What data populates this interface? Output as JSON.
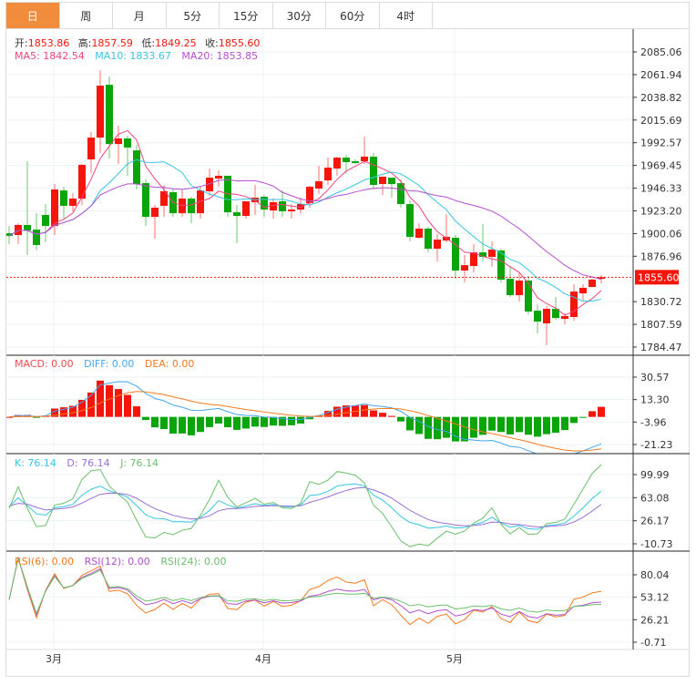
{
  "tabs": [
    {
      "label": "日",
      "active": true
    },
    {
      "label": "周"
    },
    {
      "label": "月"
    },
    {
      "label": "5分"
    },
    {
      "label": "15分"
    },
    {
      "label": "30分"
    },
    {
      "label": "60分"
    },
    {
      "label": "4时"
    }
  ],
  "ohlc_legend": {
    "open_label": "开:",
    "open": "1853.86",
    "high_label": "高:",
    "high": "1857.59",
    "low_label": "低:",
    "low": "1849.25",
    "close_label": "收:",
    "close": "1855.60"
  },
  "ma_legend": {
    "ma5": "MA5: 1842.54",
    "ma10": "MA10: 1833.67",
    "ma20": "MA20: 1853.85"
  },
  "macd_legend": {
    "macd": "MACD: 0.00",
    "diff": "DIFF: 0.00",
    "dea": "DEA: 0.00"
  },
  "kdj_legend": {
    "k": "K: 76.14",
    "d": "D: 76.14",
    "j": "J: 76.14"
  },
  "rsi_legend": {
    "rsi6": "RSI(6): 0.00",
    "rsi12": "RSI(12): 0.00",
    "rsi24": "RSI(24): 0.00"
  },
  "colors": {
    "up": "#f5150b",
    "down": "#0aa50a",
    "ma5": "#f0437a",
    "ma10": "#36c6e0",
    "ma20": "#b44fcf",
    "diff": "#44a6f0",
    "dea": "#f57a1e",
    "k": "#36c6e0",
    "d": "#9b6fd6",
    "j": "#6cc06c",
    "rsi6": "#f57a1e",
    "rsi12": "#b44fcf",
    "rsi24": "#6cc06c"
  },
  "chart_data": {
    "type": "candlestick",
    "last_price": "1855.60",
    "x_labels": [
      {
        "label": "3月",
        "index": 5
      },
      {
        "label": "4月",
        "index": 28
      },
      {
        "label": "5月",
        "index": 49
      }
    ],
    "price_ticks": [
      "2085.06",
      "2061.94",
      "2038.82",
      "2015.69",
      "1992.57",
      "1969.45",
      "1946.33",
      "1923.20",
      "1900.06",
      "1876.96",
      "1830.72",
      "1807.59",
      "1784.47"
    ],
    "price_range": [
      1784.47,
      2085.06
    ],
    "macd_ticks": [
      "30.57",
      "13.30",
      "-3.96",
      "-21.23"
    ],
    "macd_range": [
      -21.23,
      30.57
    ],
    "kdj_ticks": [
      "99.99",
      "63.08",
      "26.17",
      "-10.73"
    ],
    "kdj_range": [
      -10.73,
      99.99
    ],
    "rsi_ticks": [
      "80.04",
      "53.12",
      "26.21",
      "-0.71"
    ],
    "rsi_range": [
      -0.71,
      80.04
    ],
    "candles": [
      [
        1900.4,
        1897.6,
        1907.8,
        1889.3
      ],
      [
        1898.6,
        1908.8,
        1910.6,
        1889.3
      ],
      [
        1908.8,
        1903.2,
        1973.7,
        1878.2
      ],
      [
        1904.1,
        1888.4,
        1920.8,
        1882.8
      ],
      [
        1919.0,
        1907.8,
        1930.1,
        1891.2
      ],
      [
        1907.8,
        1945.0,
        1950.5,
        1898.6
      ],
      [
        1944.0,
        1928.3,
        1947.7,
        1915.3
      ],
      [
        1928.3,
        1935.7,
        1941.2,
        1922.7
      ],
      [
        1935.7,
        1970.0,
        1970.9,
        1929.2
      ],
      [
        1975.6,
        1997.8,
        2003.4,
        1961.7
      ],
      [
        1997.8,
        2050.7,
        2066.5,
        1982.1
      ],
      [
        2051.6,
        1991.3,
        2060.0,
        1976.5
      ],
      [
        1991.3,
        1996.9,
        2009.9,
        1970.9
      ],
      [
        1996.9,
        1987.6,
        1999.7,
        1958.9
      ],
      [
        1984.8,
        1950.5,
        1990.4,
        1945.0
      ],
      [
        1951.4,
        1917.1,
        1955.2,
        1907.8
      ],
      [
        1917.1,
        1926.4,
        1929.2,
        1894.9
      ],
      [
        1928.3,
        1943.1,
        1949.6,
        1917.1
      ],
      [
        1942.2,
        1920.8,
        1945.9,
        1917.1
      ],
      [
        1920.8,
        1935.7,
        1945.0,
        1917.1
      ],
      [
        1935.7,
        1920.8,
        1937.5,
        1910.6
      ],
      [
        1920.8,
        1944.0,
        1947.7,
        1915.3
      ],
      [
        1943.1,
        1957.0,
        1966.3,
        1938.4
      ],
      [
        1956.1,
        1958.9,
        1964.4,
        1947.7
      ],
      [
        1958.9,
        1921.8,
        1958.9,
        1917.1
      ],
      [
        1921.8,
        1918.0,
        1929.2,
        1890.2
      ],
      [
        1918.0,
        1932.9,
        1932.9,
        1915.3
      ],
      [
        1932.0,
        1936.6,
        1949.6,
        1919.0
      ],
      [
        1937.5,
        1924.5,
        1939.4,
        1917.1
      ],
      [
        1923.6,
        1932.0,
        1935.7,
        1915.3
      ],
      [
        1932.9,
        1922.7,
        1944.0,
        1917.1
      ],
      [
        1922.7,
        1924.5,
        1930.1,
        1915.3
      ],
      [
        1924.5,
        1930.1,
        1936.6,
        1919.9
      ],
      [
        1931.0,
        1947.7,
        1948.7,
        1926.4
      ],
      [
        1945.9,
        1953.3,
        1969.1,
        1940.3
      ],
      [
        1954.2,
        1967.2,
        1977.4,
        1949.6
      ],
      [
        1966.3,
        1977.4,
        1978.4,
        1958.9
      ],
      [
        1977.4,
        1972.8,
        1980.2,
        1961.7
      ],
      [
        1973.7,
        1971.9,
        1975.6,
        1970.9
      ],
      [
        1973.7,
        1978.4,
        1998.8,
        1970.9
      ],
      [
        1978.4,
        1949.6,
        1982.1,
        1945.0
      ],
      [
        1950.5,
        1958.0,
        1958.0,
        1939.4
      ],
      [
        1957.0,
        1950.5,
        1956.1,
        1936.6
      ],
      [
        1951.4,
        1930.1,
        1955.2,
        1926.4
      ],
      [
        1930.1,
        1896.7,
        1933.8,
        1892.1
      ],
      [
        1895.8,
        1905.1,
        1910.6,
        1894.9
      ],
      [
        1905.1,
        1884.6,
        1906.9,
        1880.9
      ],
      [
        1884.6,
        1893.9,
        1899.5,
        1871.7
      ],
      [
        1893.0,
        1896.7,
        1919.9,
        1891.2
      ],
      [
        1895.8,
        1862.4,
        1898.6,
        1854.0
      ],
      [
        1862.4,
        1867.9,
        1878.2,
        1850.3
      ],
      [
        1867.0,
        1880.9,
        1889.3,
        1860.5
      ],
      [
        1880.9,
        1876.3,
        1909.7,
        1871.7
      ],
      [
        1876.3,
        1883.7,
        1892.1,
        1866.1
      ],
      [
        1882.8,
        1853.1,
        1884.6,
        1850.3
      ],
      [
        1854.0,
        1837.3,
        1866.1,
        1835.5
      ],
      [
        1837.3,
        1852.2,
        1859.6,
        1830.8
      ],
      [
        1852.2,
        1820.6,
        1856.8,
        1817.8
      ],
      [
        1821.5,
        1810.4,
        1828.0,
        1798.4
      ],
      [
        1808.6,
        1823.4,
        1826.2,
        1786.3
      ],
      [
        1823.4,
        1814.1,
        1835.5,
        1812.3
      ],
      [
        1813.2,
        1816.0,
        1818.8,
        1807.6
      ],
      [
        1815.1,
        1841.0,
        1848.4,
        1811.3
      ],
      [
        1839.2,
        1844.8,
        1848.4,
        1831.8
      ],
      [
        1845.7,
        1853.1,
        1854.0,
        1845.0
      ],
      [
        1853.86,
        1855.6,
        1857.59,
        1849.25
      ]
    ]
  }
}
